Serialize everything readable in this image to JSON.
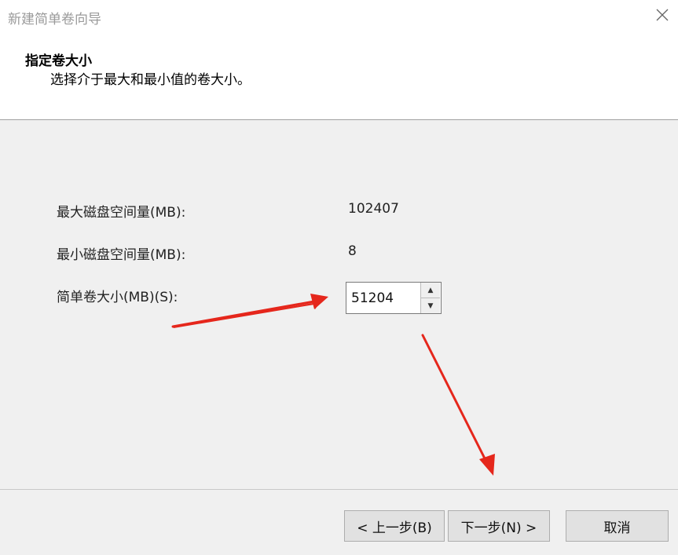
{
  "window": {
    "title": "新建简单卷向导"
  },
  "header": {
    "title": "指定卷大小",
    "subtitle": "选择介于最大和最小值的卷大小。"
  },
  "fields": {
    "max_label": "最大磁盘空间量(MB):",
    "max_value": "102407",
    "min_label": "最小磁盘空间量(MB):",
    "min_value": "8",
    "size_label": "简单卷大小(MB)(S):",
    "size_value": "51204"
  },
  "buttons": {
    "back": "< 上一步(B)",
    "next": "下一步(N) >",
    "cancel": "取消"
  },
  "colors": {
    "annotation_arrow": "#e5271c"
  }
}
